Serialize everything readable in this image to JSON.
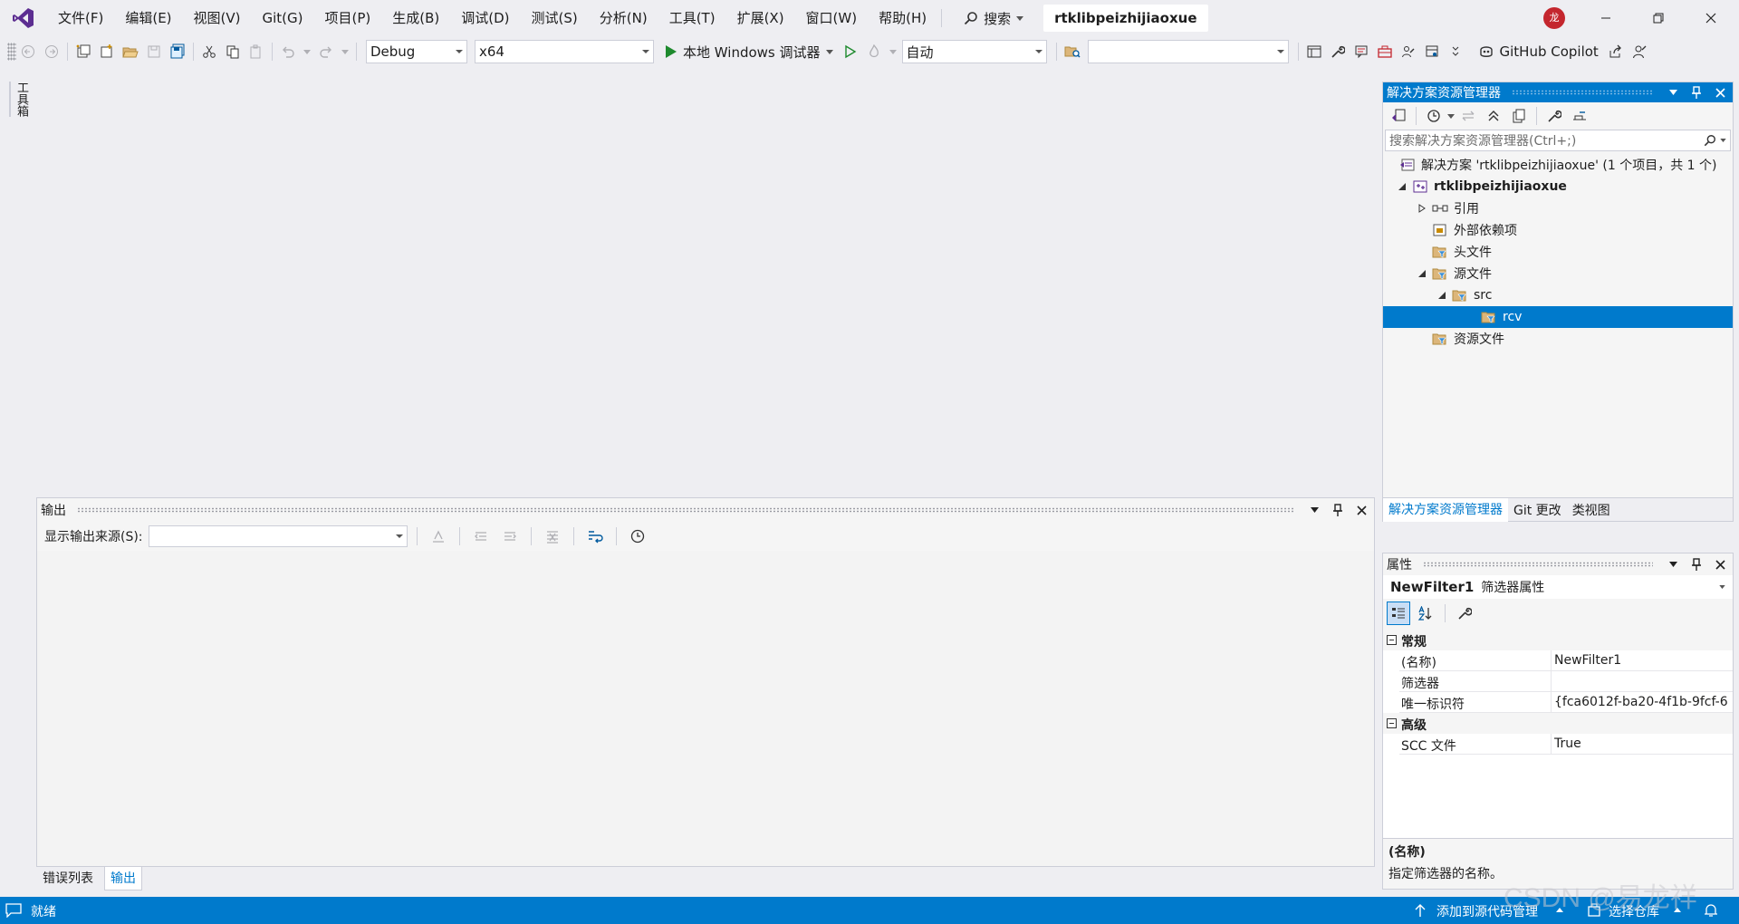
{
  "menu": {
    "items": [
      "文件(F)",
      "编辑(E)",
      "视图(V)",
      "Git(G)",
      "项目(P)",
      "生成(B)",
      "调试(D)",
      "测试(S)",
      "分析(N)",
      "工具(T)",
      "扩展(X)",
      "窗口(W)",
      "帮助(H)"
    ],
    "search_label": "搜索",
    "solution_tab": "rtklibpeizhijiaoxue",
    "avatar_text": "龙"
  },
  "toolbar": {
    "config": "Debug",
    "platform": "x64",
    "run_label": "本地 Windows 调试器",
    "auto_combo": "自动",
    "copilot_label": "GitHub Copilot"
  },
  "left_strip": {
    "toolbox_label": "工具箱"
  },
  "output": {
    "title": "输出",
    "source_label": "显示输出来源(S):",
    "source_value": ""
  },
  "bottom_tabs": {
    "error_list": "错误列表",
    "output": "输出"
  },
  "solution_explorer": {
    "title": "解决方案资源管理器",
    "search_placeholder": "搜索解决方案资源管理器(Ctrl+;)",
    "tree": [
      {
        "label": "解决方案 'rtklibpeizhijiaoxue' (1 个项目，共 1 个)",
        "icon": "solution-icon"
      },
      {
        "label": "rtklibpeizhijiaoxue",
        "icon": "project-icon"
      },
      {
        "label": "引用",
        "icon": "references-icon"
      },
      {
        "label": "外部依赖项",
        "icon": "external-deps-icon"
      },
      {
        "label": "头文件",
        "icon": "filter-folder-icon"
      },
      {
        "label": "源文件",
        "icon": "filter-folder-icon"
      },
      {
        "label": "src",
        "icon": "filter-folder-icon"
      },
      {
        "label": "rcv",
        "icon": "filter-folder-icon"
      },
      {
        "label": "资源文件",
        "icon": "filter-folder-icon"
      }
    ],
    "tabs": [
      "解决方案资源管理器",
      "Git 更改",
      "类视图"
    ]
  },
  "properties": {
    "title": "属性",
    "object_name": "NewFilter1",
    "object_type": "筛选器属性",
    "sections": [
      {
        "name": "常规",
        "rows": [
          {
            "name": "(名称)",
            "value": "NewFilter1"
          },
          {
            "name": "筛选器",
            "value": ""
          },
          {
            "name": "唯一标识符",
            "value": "{fca6012f-ba20-4f1b-9fcf-6"
          }
        ]
      },
      {
        "name": "高级",
        "rows": [
          {
            "name": "SCC 文件",
            "value": "True"
          }
        ]
      }
    ],
    "desc_title": "(名称)",
    "desc_text": "指定筛选器的名称。"
  },
  "status": {
    "ready": "就绪",
    "add_source_control": "添加到源代码管理",
    "select_repo": "选择仓库"
  },
  "watermark": "CSDN @易龙祥",
  "colors": {
    "accent": "#007acc",
    "background": "#eeeef2",
    "panel": "#f5f5f5",
    "vs_purple": "#5c2d91",
    "run_green": "#1e8a2e"
  }
}
